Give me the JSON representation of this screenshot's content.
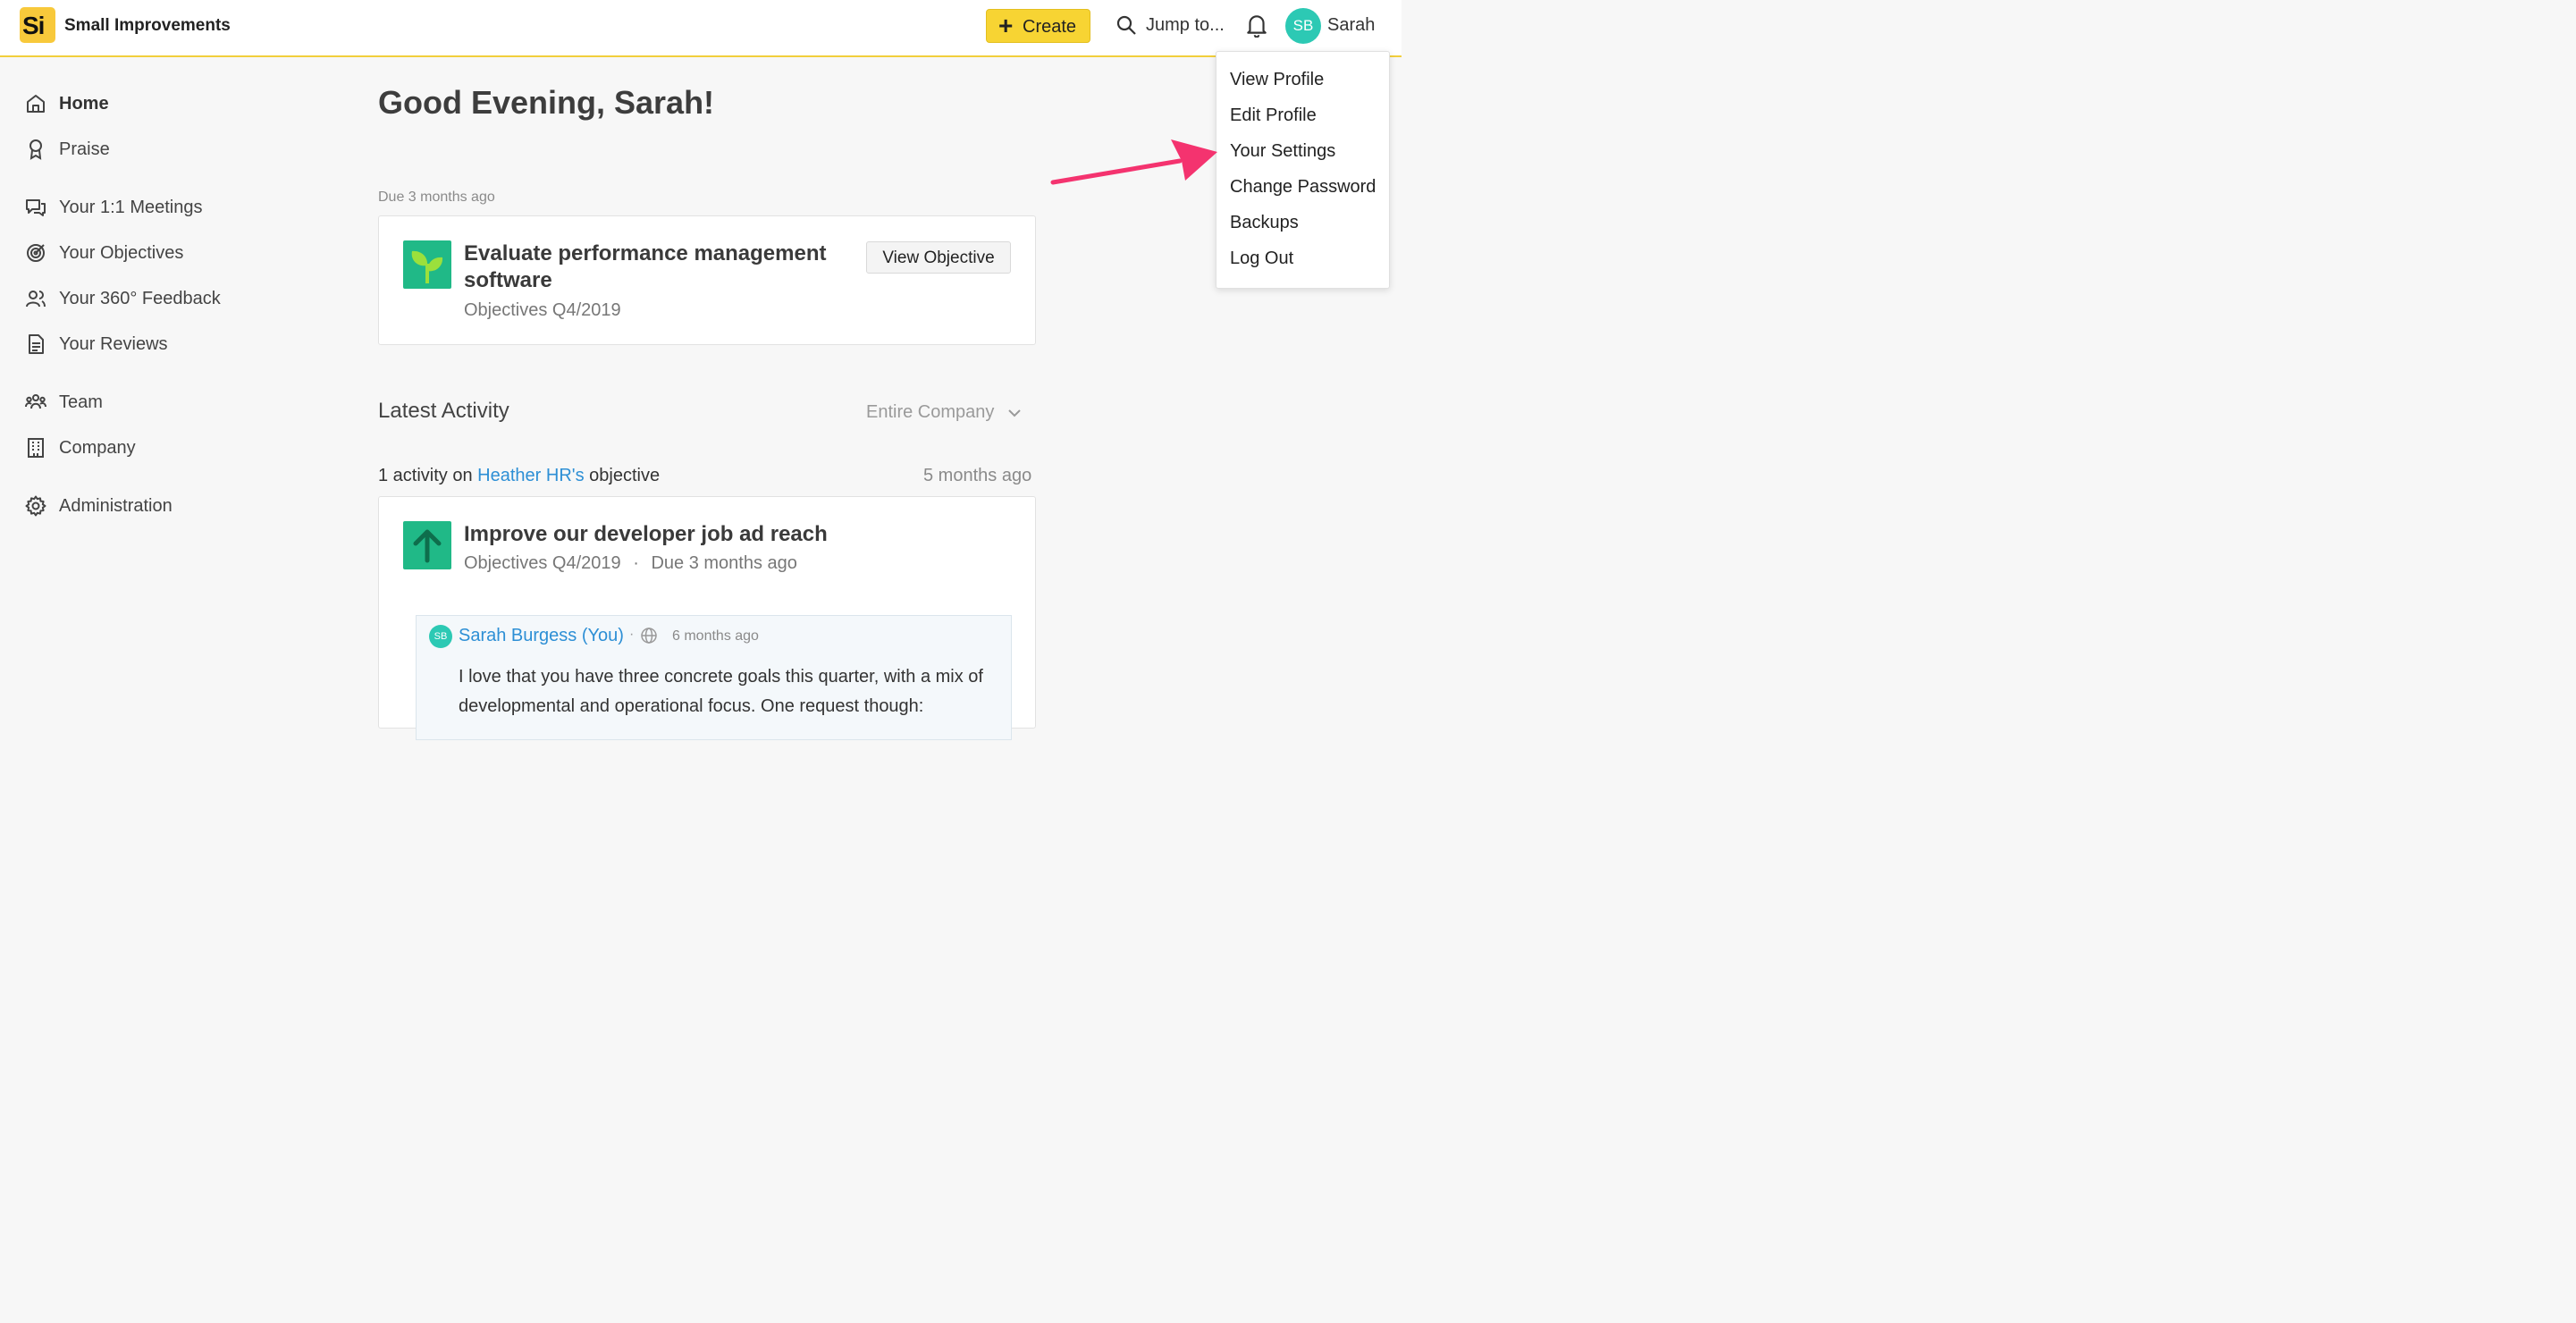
{
  "header": {
    "logo_text": "Si",
    "brand": "Small Improvements",
    "create_label": "Create",
    "jump_label": "Jump to...",
    "avatar_initials": "SB",
    "user_name": "Sarah"
  },
  "sidebar": {
    "items": [
      {
        "label": "Home",
        "icon": "home-icon",
        "active": true
      },
      {
        "label": "Praise",
        "icon": "award-icon"
      },
      {
        "label": "Your 1:1 Meetings",
        "icon": "chat-icon"
      },
      {
        "label": "Your Objectives",
        "icon": "target-icon"
      },
      {
        "label": "Your 360° Feedback",
        "icon": "people-icon"
      },
      {
        "label": "Your Reviews",
        "icon": "document-icon"
      },
      {
        "label": "Team",
        "icon": "team-icon"
      },
      {
        "label": "Company",
        "icon": "building-icon"
      },
      {
        "label": "Administration",
        "icon": "gear-icon"
      }
    ]
  },
  "main": {
    "greeting": "Good Evening, Sarah!",
    "due_label": "Due 3 months ago",
    "objective_card": {
      "title": "Evaluate performance management software",
      "subtitle": "Objectives Q4/2019",
      "button": "View Objective",
      "icon": "sprout-icon"
    },
    "latest_activity": "Latest Activity",
    "filter": "Entire Company",
    "activity": {
      "prefix": "1 activity on",
      "link": "Heather HR's",
      "suffix": "objective",
      "time": "5 months ago",
      "title": "Improve our developer job ad reach",
      "subtitle": "Objectives Q4/2019",
      "separator": "·",
      "due": "Due 3 months ago",
      "icon": "arrow-up-icon",
      "comment": {
        "avatar_initials": "SB",
        "author": "Sarah Burgess (You)",
        "dot": "·",
        "time": "6 months ago",
        "text": "I love that you have three concrete goals this quarter, with a mix of developmental and operational focus. One request though:"
      }
    }
  },
  "dropdown": {
    "items": [
      "View Profile",
      "Edit Profile",
      "Your Settings",
      "Change Password",
      "Backups",
      "Log Out"
    ]
  },
  "colors": {
    "accent_yellow": "#f7d433",
    "avatar_teal": "#2cc9b4",
    "objective_green": "#20b987",
    "link_blue": "#2d8fd5",
    "arrow_pink": "#f4336f"
  }
}
